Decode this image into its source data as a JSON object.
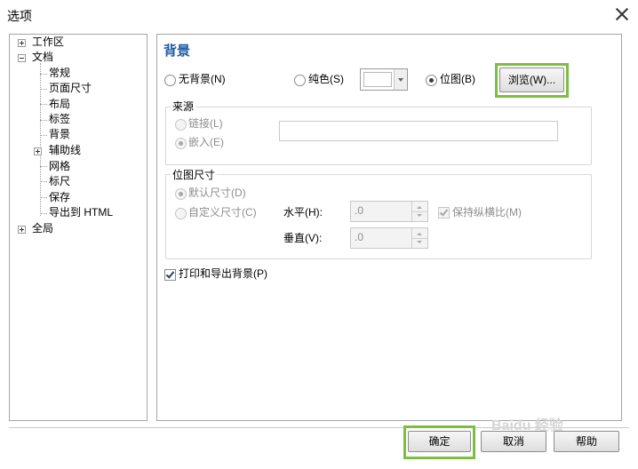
{
  "window": {
    "title": "选项"
  },
  "tree": {
    "items": [
      {
        "label": "工作区"
      },
      {
        "label": "文档"
      },
      {
        "label": "常规"
      },
      {
        "label": "页面尺寸"
      },
      {
        "label": "布局"
      },
      {
        "label": "标签"
      },
      {
        "label": "背景"
      },
      {
        "label": "辅助线"
      },
      {
        "label": "网格"
      },
      {
        "label": "标尺"
      },
      {
        "label": "保存"
      },
      {
        "label": "导出到 HTML"
      },
      {
        "label": "全局"
      }
    ]
  },
  "background": {
    "section_title": "背景",
    "no_background": "无背景(N)",
    "solid": "纯色(S)",
    "bitmap": "位图(B)",
    "browse": "浏览(W)...",
    "source": {
      "title": "来源",
      "link": "链接(L)",
      "embed": "嵌入(E)",
      "path_value": ""
    },
    "bitmap_size": {
      "title": "位图尺寸",
      "default_size": "默认尺寸(D)",
      "custom_size": "自定义尺寸(C)",
      "horizontal_label": "水平(H):",
      "horizontal_value": ".0",
      "vertical_label": "垂直(V):",
      "vertical_value": ".0",
      "keep_ratio": "保持纵横比(M)"
    },
    "print_export": "打印和导出背景(P)"
  },
  "footer": {
    "ok": "确定",
    "cancel": "取消",
    "help": "帮助"
  },
  "watermark": "Baidu 经验",
  "colors": {
    "highlight": "#7cbf3f",
    "section_title": "#1a5aa6"
  }
}
